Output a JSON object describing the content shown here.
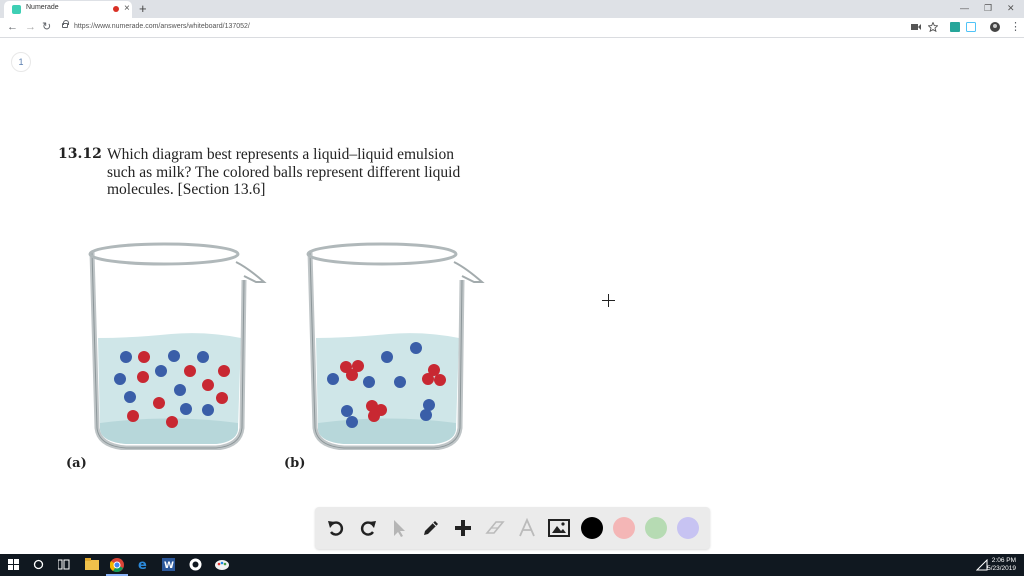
{
  "browser": {
    "tab_title": "Numerade",
    "new_tab": "+",
    "close": "×",
    "url": "https://www.numerade.com/answers/whiteboard/137052/",
    "window_controls": {
      "minimize": "—",
      "restore": "❐",
      "close": "✕"
    },
    "nav": {
      "back": "←",
      "forward": "→",
      "reload": "↻"
    }
  },
  "whiteboard": {
    "page_number": "1",
    "question": {
      "number": "13.12",
      "lines": [
        "Which diagram best represents a liquid–liquid emulsion",
        "such as milk? The colored balls represent different liquid",
        "molecules. [Section 13.6]"
      ]
    },
    "diagrams": {
      "a_label": "(a)",
      "b_label": "(b)"
    }
  },
  "toolbar": {
    "tools": [
      "undo-icon",
      "redo-icon",
      "select-pointer-icon",
      "pen-icon",
      "add-icon",
      "eraser-icon",
      "text-icon",
      "image-icon"
    ],
    "colors": [
      "#000000",
      "#f4b6b6",
      "#b6dbb3",
      "#c7c3f2"
    ]
  },
  "taskbar": {
    "time": "2:06 PM",
    "date": "5/23/2019"
  }
}
